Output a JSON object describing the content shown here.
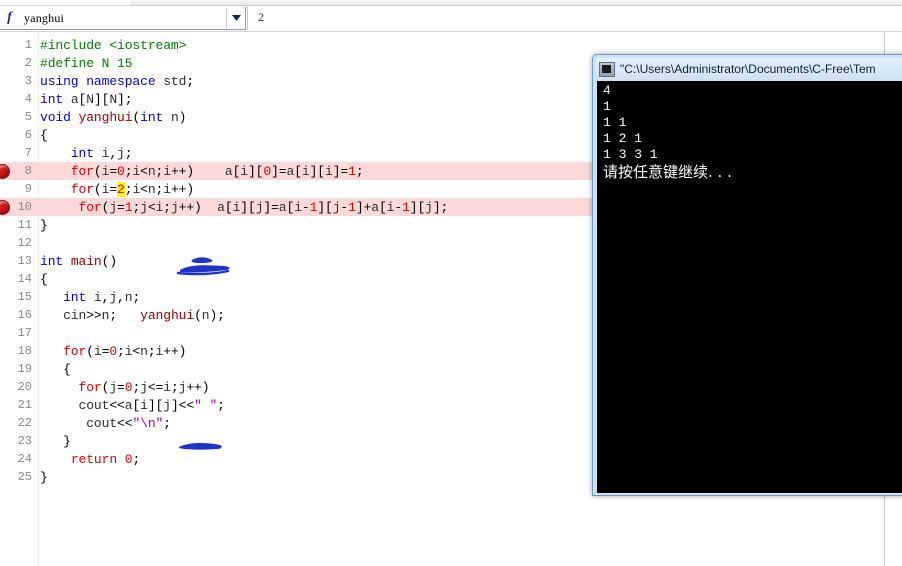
{
  "combo": {
    "icon": "function-icon",
    "value": "yanghui",
    "placeholder": "yanghui",
    "arrow_icon": "chevron-down-icon",
    "number": "2"
  },
  "editor": {
    "lines": [
      {
        "num": "1",
        "breakpoint": false,
        "highlight": false,
        "text": "#include <iostream>"
      },
      {
        "num": "2",
        "breakpoint": false,
        "highlight": false,
        "text": "#define N 15"
      },
      {
        "num": "3",
        "breakpoint": false,
        "highlight": false,
        "text": "using namespace std;"
      },
      {
        "num": "4",
        "breakpoint": false,
        "highlight": false,
        "text": "int a[N][N];"
      },
      {
        "num": "5",
        "breakpoint": false,
        "highlight": false,
        "text": "void yanghui(int n)"
      },
      {
        "num": "6",
        "breakpoint": false,
        "highlight": false,
        "text": "{"
      },
      {
        "num": "7",
        "breakpoint": false,
        "highlight": false,
        "text": "    int i,j;"
      },
      {
        "num": "8",
        "breakpoint": true,
        "highlight": true,
        "text": "    for(i=0;i<n;i++)    a[i][0]=a[i][i]=1;"
      },
      {
        "num": "9",
        "breakpoint": false,
        "highlight": false,
        "text": "    for(i=2;i<n;i++)"
      },
      {
        "num": "10",
        "breakpoint": true,
        "highlight": true,
        "text": "     for(j=1;j<i;j++)  a[i][j]=a[i-1][j-1]+a[i-1][j];"
      },
      {
        "num": "11",
        "breakpoint": false,
        "highlight": false,
        "text": "}"
      },
      {
        "num": "12",
        "breakpoint": false,
        "highlight": false,
        "text": ""
      },
      {
        "num": "13",
        "breakpoint": false,
        "highlight": false,
        "text": "int main()"
      },
      {
        "num": "14",
        "breakpoint": false,
        "highlight": false,
        "text": "{"
      },
      {
        "num": "15",
        "breakpoint": false,
        "highlight": false,
        "text": "   int i,j,n;"
      },
      {
        "num": "16",
        "breakpoint": false,
        "highlight": false,
        "text": "   cin>>n;   yanghui(n);"
      },
      {
        "num": "17",
        "breakpoint": false,
        "highlight": false,
        "text": ""
      },
      {
        "num": "18",
        "breakpoint": false,
        "highlight": false,
        "text": "   for(i=0;i<n;i++)"
      },
      {
        "num": "19",
        "breakpoint": false,
        "highlight": false,
        "text": "   {"
      },
      {
        "num": "20",
        "breakpoint": false,
        "highlight": false,
        "text": "     for(j=0;j<=i;j++)"
      },
      {
        "num": "21",
        "breakpoint": false,
        "highlight": false,
        "text": "     cout<<a[i][j]<<\" \";"
      },
      {
        "num": "22",
        "breakpoint": false,
        "highlight": false,
        "text": "      cout<<\"\\n\";"
      },
      {
        "num": "23",
        "breakpoint": false,
        "highlight": false,
        "text": "   }"
      },
      {
        "num": "24",
        "breakpoint": false,
        "highlight": false,
        "text": "    return 0;"
      },
      {
        "num": "25",
        "breakpoint": false,
        "highlight": false,
        "text": "}"
      }
    ],
    "search_match": "2",
    "annotations": [
      {
        "name": "ink-scribble-line11",
        "shape": "scribble"
      },
      {
        "name": "ink-underline-line20",
        "shape": "underline"
      }
    ],
    "colors": {
      "highlight_line": "#fbd9d9",
      "breakpoint": "#d01717",
      "search_match": "#ffff00",
      "keyword": "#0000e6",
      "preprocessor": "#008000",
      "number": "#e60000",
      "string": "#b000b0",
      "function": "#a00000"
    }
  },
  "console": {
    "icon": "console-window-icon",
    "title": "\"C:\\Users\\Administrator\\Documents\\C-Free\\Tem",
    "output": [
      {
        "text": "4",
        "cjk": false
      },
      {
        "text": "1",
        "cjk": false
      },
      {
        "text": "1 1",
        "cjk": false
      },
      {
        "text": "1 2 1",
        "cjk": false
      },
      {
        "text": "1 3 3 1",
        "cjk": false
      },
      {
        "text": "请按任意键继续. . .",
        "cjk": true
      }
    ]
  }
}
